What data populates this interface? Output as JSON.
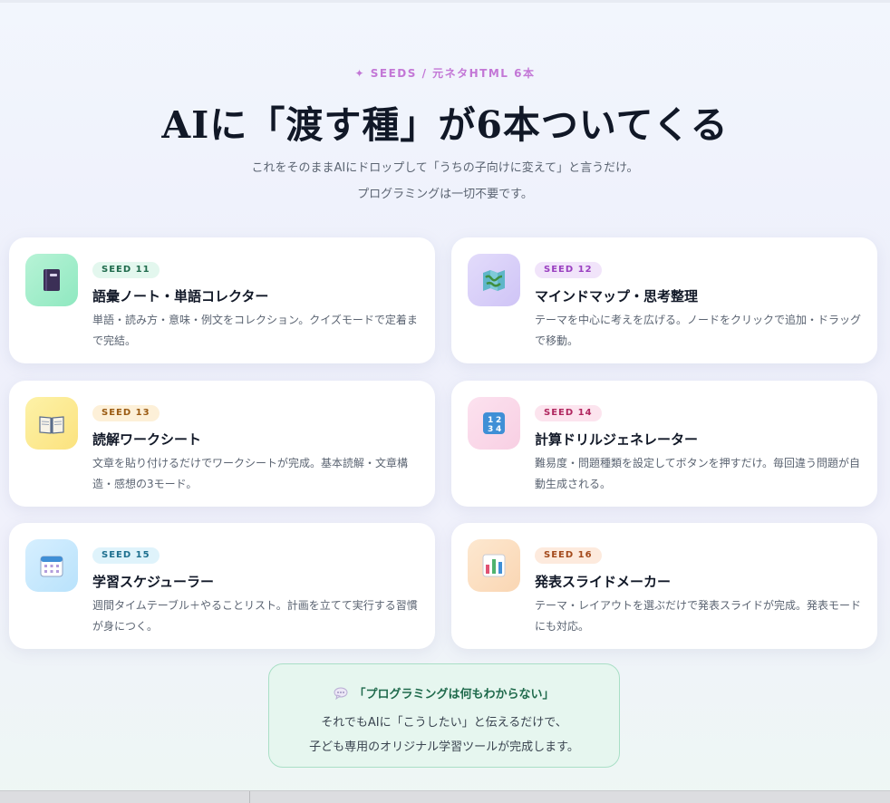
{
  "header": {
    "eyebrow": "✦ SEEDS / 元ネタHTML 6本",
    "title": "AIに「渡す種」が6本ついてくる",
    "subtitle_line1": "これをそのままAIにドロップして「うちの子向けに変えて」と言うだけ。",
    "subtitle_line2": "プログラミングは一切不要です。"
  },
  "cards": [
    {
      "badge": "SEED 11",
      "title": "語彙ノート・単語コレクター",
      "description": "単語・読み方・意味・例文をコレクション。クイズモードで定着まで完結。",
      "icon": "notebook-icon"
    },
    {
      "badge": "SEED 12",
      "title": "マインドマップ・思考整理",
      "description": "テーマを中心に考えを広げる。ノードをクリックで追加・ドラッグで移動。",
      "icon": "map-icon"
    },
    {
      "badge": "SEED 13",
      "title": "読解ワークシート",
      "description": "文章を貼り付けるだけでワークシートが完成。基本読解・文章構造・感想の3モード。",
      "icon": "open-book-icon"
    },
    {
      "badge": "SEED 14",
      "title": "計算ドリルジェネレーター",
      "description": "難易度・問題種類を設定してボタンを押すだけ。毎回違う問題が自動生成される。",
      "icon": "numbers-icon"
    },
    {
      "badge": "SEED 15",
      "title": "学習スケジューラー",
      "description": "週間タイムテーブル＋やることリスト。計画を立てて実行する習慣が身につく。",
      "icon": "calendar-icon"
    },
    {
      "badge": "SEED 16",
      "title": "発表スライドメーカー",
      "description": "テーマ・レイアウトを選ぶだけで発表スライドが完成。発表モードにも対応。",
      "icon": "bar-chart-icon"
    }
  ],
  "note": {
    "icon": "speech-bubble-icon",
    "headline": "「プログラミングは何もわからない」",
    "line1": "それでもAIに「こうしたい」と伝えるだけで、",
    "line2": "子ども専用のオリジナル学習ツールが完成します。"
  },
  "colors": {
    "accent_purple": "#c377d6",
    "note_green": "#1f6a4c"
  }
}
